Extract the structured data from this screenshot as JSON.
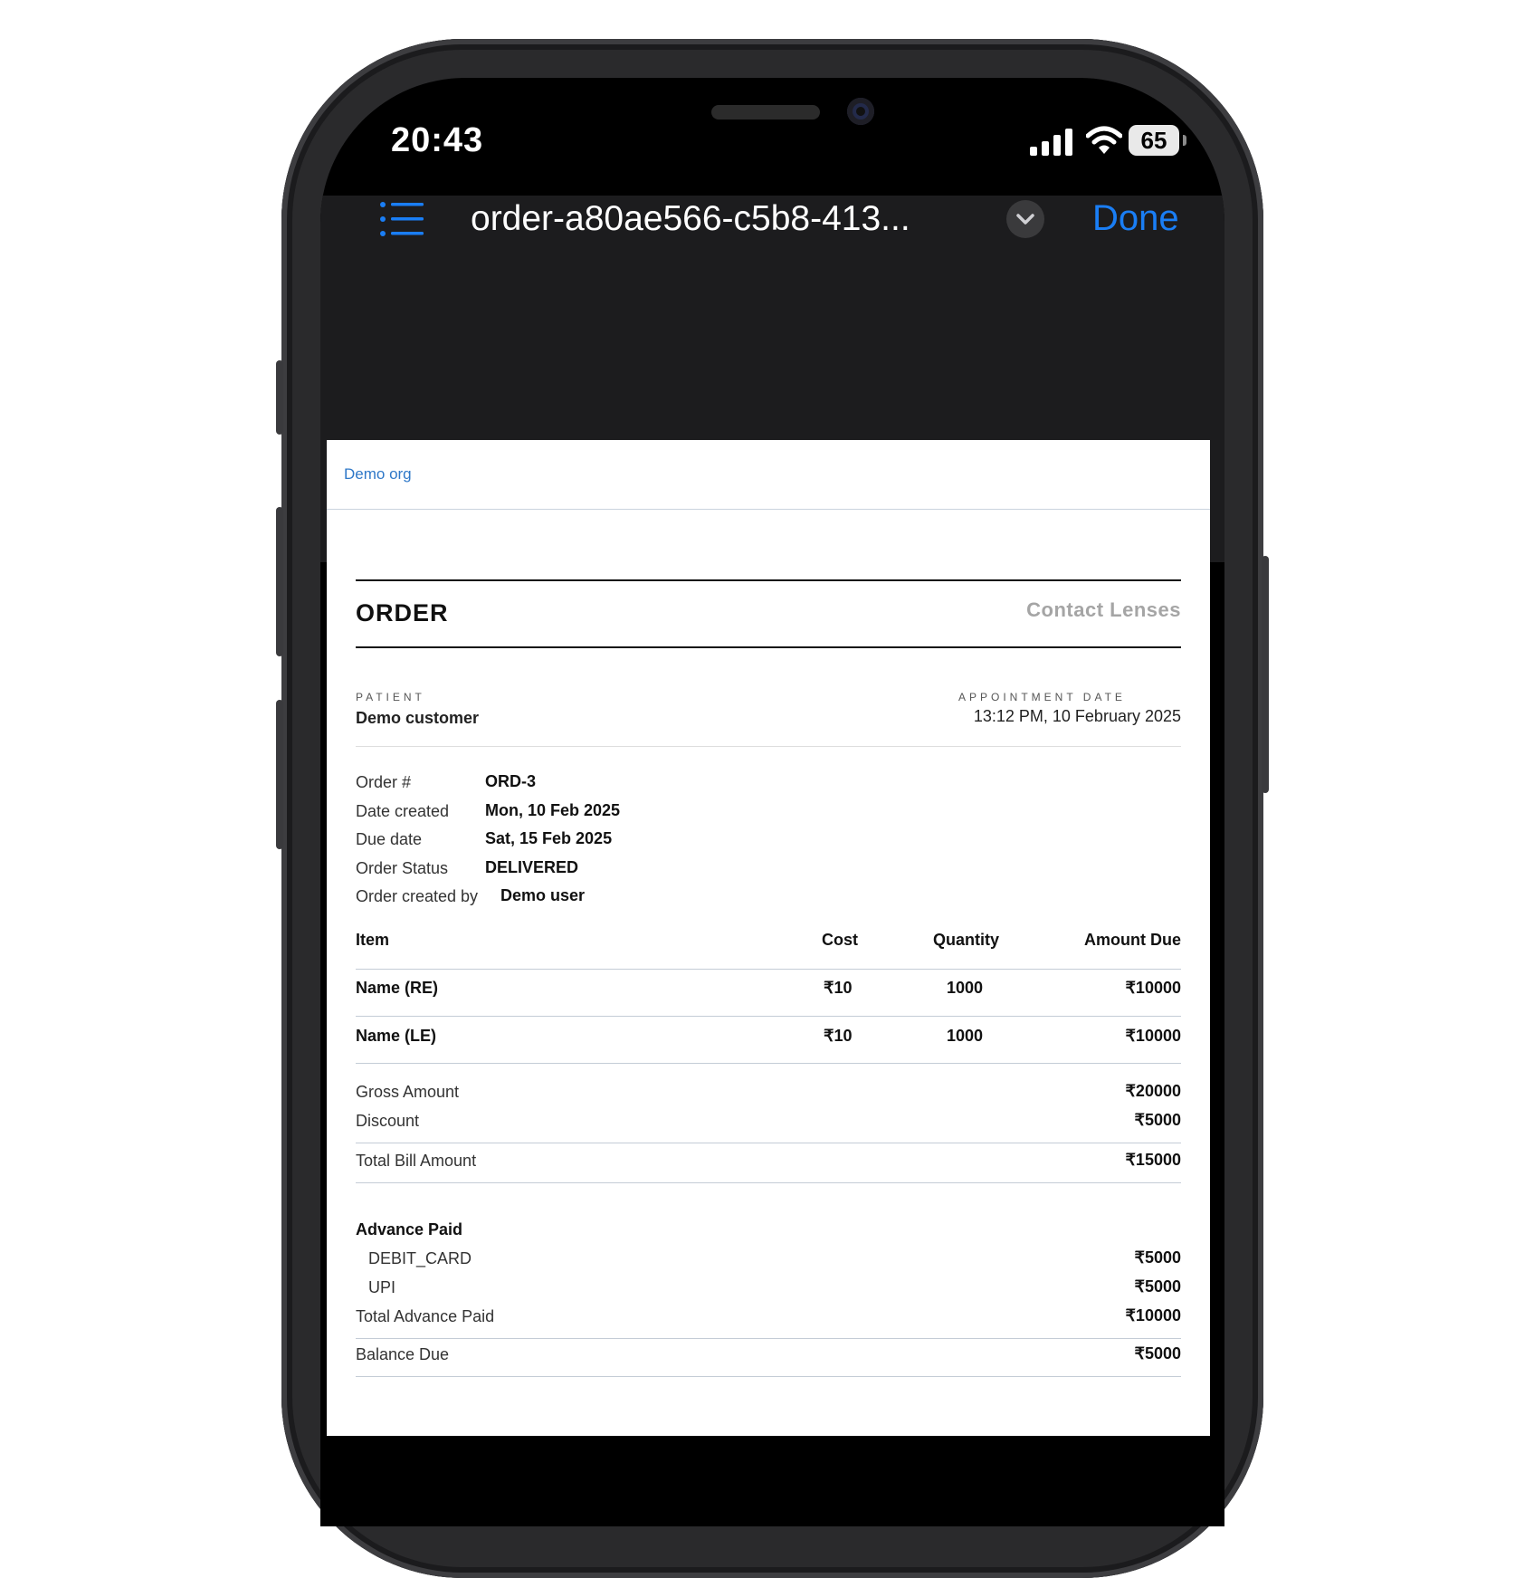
{
  "status_bar": {
    "time": "20:43",
    "battery": "65"
  },
  "toolbar": {
    "document_title": "order-a80ae566-c5b8-413...",
    "done_label": "Done"
  },
  "document": {
    "org_name": "Demo org",
    "heading": "ORDER",
    "category": "Contact Lenses",
    "patient_label": "PATIENT",
    "patient_name": "Demo customer",
    "appointment_label": "APPOINTMENT DATE",
    "appointment_value": "13:12 PM, 10 February 2025",
    "info": [
      {
        "label": "Order #",
        "value": "ORD-3"
      },
      {
        "label": "Date created",
        "value": "Mon, 10 Feb 2025"
      },
      {
        "label": "Due date",
        "value": "Sat, 15 Feb 2025"
      },
      {
        "label": "Order Status",
        "value": "DELIVERED"
      },
      {
        "label": "Order created by",
        "value": "Demo user"
      }
    ],
    "table": {
      "headers": [
        "Item",
        "Cost",
        "Quantity",
        "Amount Due"
      ],
      "rows": [
        [
          "Name (RE)",
          "₹10",
          "1000",
          "₹10000"
        ],
        [
          "Name (LE)",
          "₹10",
          "1000",
          "₹10000"
        ]
      ]
    },
    "summary": {
      "gross_label": "Gross Amount",
      "gross_value": "₹20000",
      "discount_label": "Discount",
      "discount_value": "₹5000",
      "total_label": "Total Bill Amount",
      "total_value": "₹15000",
      "advance_heading": "Advance Paid",
      "payments": [
        {
          "label": "DEBIT_CARD",
          "value": "₹5000"
        },
        {
          "label": "UPI",
          "value": "₹5000"
        }
      ],
      "total_advance_label": "Total Advance Paid",
      "total_advance_value": "₹10000",
      "balance_label": "Balance Due",
      "balance_value": "₹5000"
    }
  },
  "colors": {
    "accent": "#1a7ef5",
    "org_link": "#2f78c8",
    "toolbar_bg": "#1c1c1e"
  },
  "icons": [
    "list-icon",
    "chevron-down-icon",
    "signal-icon",
    "wifi-icon",
    "battery-icon"
  ]
}
